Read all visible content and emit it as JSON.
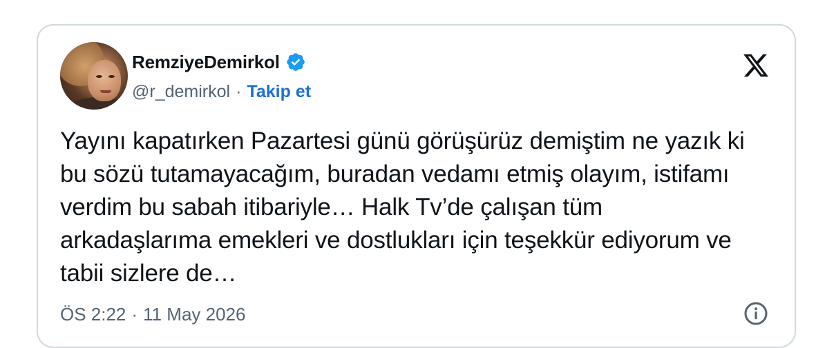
{
  "tweet": {
    "author": {
      "display_name": "RemziyeDemirkol",
      "handle": "@r_demirkol",
      "verified": true
    },
    "follow_separator": "·",
    "follow_label": "Takip et",
    "text": "Yayını kapatırken Pazartesi günü görüşürüz demiştim ne yazık ki bu sözü tutamayacağım, buradan vedamı etmiş olayım, istifamı verdim bu sabah itibariyle… Halk Tv’de çalışan tüm arkadaşlarıma emekleri ve dostlukları için teşekkür ediyorum ve tabii sizlere de…",
    "time": "ÖS 2:22",
    "meta_separator": "·",
    "date": "11 May 2026"
  },
  "icons": {
    "verified": "verified-badge-icon",
    "brand": "x-logo-icon",
    "info": "info-icon"
  },
  "colors": {
    "text": "#0f1419",
    "secondary": "#536471",
    "link": "#1d6fd1",
    "verified": "#1d9bf0",
    "border": "#cfd9de"
  }
}
